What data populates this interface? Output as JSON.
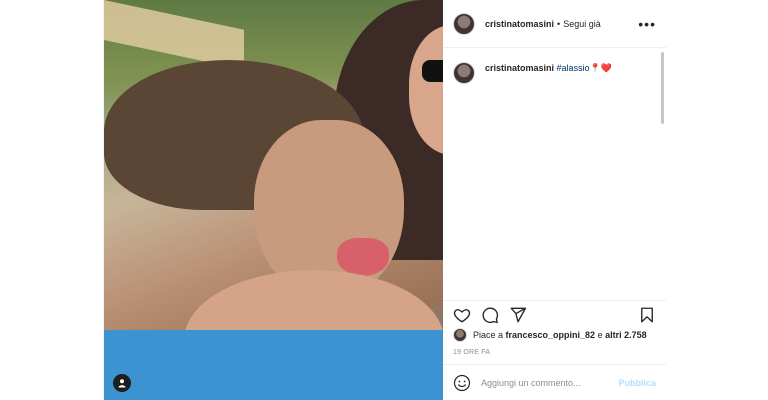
{
  "post": {
    "username": "cristinatomasini",
    "separator": "•",
    "follow_status": "Segui già",
    "more_label": "•••"
  },
  "caption": {
    "username": "cristinatomasini",
    "hashtag": "#alassio",
    "emoji": "📍❤️"
  },
  "likes": {
    "prefix": "Piace a ",
    "user": "francesco_oppini_82",
    "middle": " e ",
    "others": "altri 2.758"
  },
  "time_ago": "19 ORE FA",
  "comment_box": {
    "placeholder": "Aggiungi un commento...",
    "publish_label": "Pubblica"
  },
  "icons": {
    "like": "heart-icon",
    "comment": "comment-icon",
    "share": "paper-plane-icon",
    "save": "bookmark-icon",
    "emoji": "smiley-icon",
    "tag": "user-tag-icon"
  },
  "colors": {
    "link": "#00376b",
    "muted": "#8e8e8e",
    "publish_disabled": "#b2dffc"
  }
}
